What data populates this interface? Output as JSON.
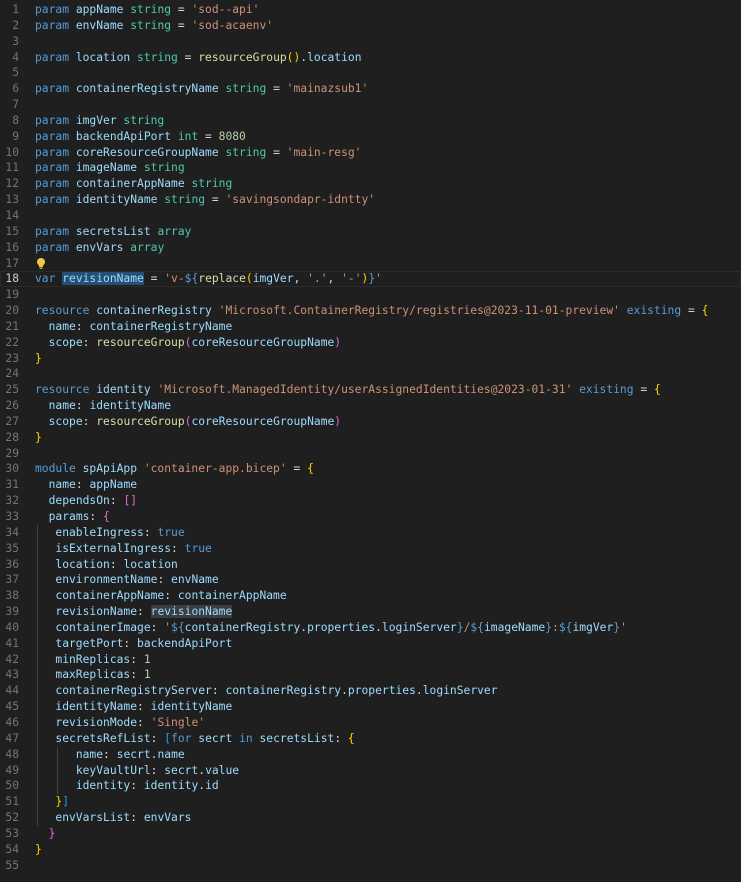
{
  "editor": {
    "current_line": 18,
    "lines": [
      {
        "n": "1",
        "t": [
          [
            "kw",
            "param "
          ],
          [
            "id",
            "appName "
          ],
          [
            "ty",
            "string"
          ],
          [
            "pl",
            " = "
          ],
          [
            "st",
            "'sod--api'"
          ]
        ]
      },
      {
        "n": "2",
        "t": [
          [
            "kw",
            "param "
          ],
          [
            "id",
            "envName "
          ],
          [
            "ty",
            "string"
          ],
          [
            "pl",
            " = "
          ],
          [
            "st",
            "'sod-acaenv'"
          ]
        ]
      },
      {
        "n": "3",
        "t": []
      },
      {
        "n": "4",
        "t": [
          [
            "kw",
            "param "
          ],
          [
            "id",
            "location "
          ],
          [
            "ty",
            "string"
          ],
          [
            "pl",
            " = "
          ],
          [
            "fn",
            "resourceGroup"
          ],
          [
            "b1",
            "()"
          ],
          [
            "pl",
            "."
          ],
          [
            "id",
            "location"
          ]
        ]
      },
      {
        "n": "5",
        "t": []
      },
      {
        "n": "6",
        "t": [
          [
            "kw",
            "param "
          ],
          [
            "id",
            "containerRegistryName "
          ],
          [
            "ty",
            "string"
          ],
          [
            "pl",
            " = "
          ],
          [
            "st",
            "'mainazsub1'"
          ]
        ]
      },
      {
        "n": "7",
        "t": []
      },
      {
        "n": "8",
        "t": [
          [
            "kw",
            "param "
          ],
          [
            "id",
            "imgVer "
          ],
          [
            "ty",
            "string"
          ]
        ]
      },
      {
        "n": "9",
        "t": [
          [
            "kw",
            "param "
          ],
          [
            "id",
            "backendApiPort "
          ],
          [
            "ty",
            "int"
          ],
          [
            "pl",
            " = "
          ],
          [
            "nu",
            "8080"
          ]
        ]
      },
      {
        "n": "10",
        "t": [
          [
            "kw",
            "param "
          ],
          [
            "id",
            "coreResourceGroupName "
          ],
          [
            "ty",
            "string"
          ],
          [
            "pl",
            " = "
          ],
          [
            "st",
            "'main-resg'"
          ]
        ]
      },
      {
        "n": "11",
        "t": [
          [
            "kw",
            "param "
          ],
          [
            "id",
            "imageName "
          ],
          [
            "ty",
            "string"
          ]
        ]
      },
      {
        "n": "12",
        "t": [
          [
            "kw",
            "param "
          ],
          [
            "id",
            "containerAppName "
          ],
          [
            "ty",
            "string"
          ]
        ]
      },
      {
        "n": "13",
        "t": [
          [
            "kw",
            "param "
          ],
          [
            "id",
            "identityName "
          ],
          [
            "ty",
            "string"
          ],
          [
            "pl",
            " = "
          ],
          [
            "st",
            "'savingsondapr-idntty'"
          ]
        ]
      },
      {
        "n": "14",
        "t": []
      },
      {
        "n": "15",
        "t": [
          [
            "kw",
            "param "
          ],
          [
            "id",
            "secretsList "
          ],
          [
            "ty",
            "array"
          ]
        ]
      },
      {
        "n": "16",
        "t": [
          [
            "kw",
            "param "
          ],
          [
            "id",
            "envVars "
          ],
          [
            "ty",
            "array"
          ]
        ]
      },
      {
        "n": "17",
        "t": [],
        "bulb": true
      },
      {
        "n": "18",
        "t": [
          [
            "kw",
            "var "
          ],
          [
            "hl",
            "revisionName"
          ],
          [
            "pl",
            " = "
          ],
          [
            "st",
            "'v-"
          ],
          [
            "kw",
            "${"
          ],
          [
            "fn",
            "replace"
          ],
          [
            "b1",
            "("
          ],
          [
            "id",
            "imgVer"
          ],
          [
            "pl",
            ", "
          ],
          [
            "st",
            "'.'"
          ],
          [
            "pl",
            ", "
          ],
          [
            "st",
            "'-'"
          ],
          [
            "b1",
            ")"
          ],
          [
            "kw",
            "}"
          ],
          [
            "st",
            "'"
          ]
        ]
      },
      {
        "n": "19",
        "t": []
      },
      {
        "n": "20",
        "t": [
          [
            "kw",
            "resource "
          ],
          [
            "id",
            "containerRegistry "
          ],
          [
            "st",
            "'Microsoft.ContainerRegistry/registries@2023-11-01-preview'"
          ],
          [
            "kw",
            " existing"
          ],
          [
            "pl",
            " = "
          ],
          [
            "b1",
            "{"
          ]
        ]
      },
      {
        "n": "21",
        "t": [
          [
            "pl",
            "  "
          ],
          [
            "id",
            "name"
          ],
          [
            "pl",
            ": "
          ],
          [
            "id",
            "containerRegistryName"
          ]
        ]
      },
      {
        "n": "22",
        "t": [
          [
            "pl",
            "  "
          ],
          [
            "id",
            "scope"
          ],
          [
            "pl",
            ": "
          ],
          [
            "fn",
            "resourceGroup"
          ],
          [
            "b2",
            "("
          ],
          [
            "id",
            "coreResourceGroupName"
          ],
          [
            "b2",
            ")"
          ]
        ]
      },
      {
        "n": "23",
        "t": [
          [
            "b1",
            "}"
          ]
        ]
      },
      {
        "n": "24",
        "t": []
      },
      {
        "n": "25",
        "t": [
          [
            "kw",
            "resource "
          ],
          [
            "id",
            "identity "
          ],
          [
            "st",
            "'Microsoft.ManagedIdentity/userAssignedIdentities@2023-01-31'"
          ],
          [
            "kw",
            " existing"
          ],
          [
            "pl",
            " = "
          ],
          [
            "b1",
            "{"
          ]
        ]
      },
      {
        "n": "26",
        "t": [
          [
            "pl",
            "  "
          ],
          [
            "id",
            "name"
          ],
          [
            "pl",
            ": "
          ],
          [
            "id",
            "identityName"
          ]
        ]
      },
      {
        "n": "27",
        "t": [
          [
            "pl",
            "  "
          ],
          [
            "id",
            "scope"
          ],
          [
            "pl",
            ": "
          ],
          [
            "fn",
            "resourceGroup"
          ],
          [
            "b2",
            "("
          ],
          [
            "id",
            "coreResourceGroupName"
          ],
          [
            "b2",
            ")"
          ]
        ]
      },
      {
        "n": "28",
        "t": [
          [
            "b1",
            "}"
          ]
        ]
      },
      {
        "n": "29",
        "t": []
      },
      {
        "n": "30",
        "t": [
          [
            "kw",
            "module "
          ],
          [
            "id",
            "spApiApp "
          ],
          [
            "st",
            "'container-app.bicep'"
          ],
          [
            "pl",
            " = "
          ],
          [
            "b1",
            "{"
          ]
        ]
      },
      {
        "n": "31",
        "t": [
          [
            "pl",
            "  "
          ],
          [
            "id",
            "name"
          ],
          [
            "pl",
            ": "
          ],
          [
            "id",
            "appName"
          ]
        ]
      },
      {
        "n": "32",
        "t": [
          [
            "pl",
            "  "
          ],
          [
            "id",
            "dependsOn"
          ],
          [
            "pl",
            ": "
          ],
          [
            "b2",
            "[]"
          ]
        ]
      },
      {
        "n": "33",
        "t": [
          [
            "pl",
            "  "
          ],
          [
            "id",
            "params"
          ],
          [
            "pl",
            ": "
          ],
          [
            "b2",
            "{"
          ]
        ]
      },
      {
        "n": "34",
        "t": [
          [
            "g",
            ""
          ],
          [
            "pl",
            "   "
          ],
          [
            "id",
            "enableIngress"
          ],
          [
            "pl",
            ": "
          ],
          [
            "kw",
            "true"
          ]
        ]
      },
      {
        "n": "35",
        "t": [
          [
            "g",
            ""
          ],
          [
            "pl",
            "   "
          ],
          [
            "id",
            "isExternalIngress"
          ],
          [
            "pl",
            ": "
          ],
          [
            "kw",
            "true"
          ]
        ]
      },
      {
        "n": "36",
        "t": [
          [
            "g",
            ""
          ],
          [
            "pl",
            "   "
          ],
          [
            "id",
            "location"
          ],
          [
            "pl",
            ": "
          ],
          [
            "id",
            "location"
          ]
        ]
      },
      {
        "n": "37",
        "t": [
          [
            "g",
            ""
          ],
          [
            "pl",
            "   "
          ],
          [
            "id",
            "environmentName"
          ],
          [
            "pl",
            ": "
          ],
          [
            "id",
            "envName"
          ]
        ]
      },
      {
        "n": "38",
        "t": [
          [
            "g",
            ""
          ],
          [
            "pl",
            "   "
          ],
          [
            "id",
            "containerAppName"
          ],
          [
            "pl",
            ": "
          ],
          [
            "id",
            "containerAppName"
          ]
        ]
      },
      {
        "n": "39",
        "t": [
          [
            "g",
            ""
          ],
          [
            "pl",
            "   "
          ],
          [
            "id",
            "revisionName"
          ],
          [
            "pl",
            ": "
          ],
          [
            "hl2",
            "revisionName"
          ]
        ]
      },
      {
        "n": "40",
        "t": [
          [
            "g",
            ""
          ],
          [
            "pl",
            "   "
          ],
          [
            "id",
            "containerImage"
          ],
          [
            "pl",
            ": "
          ],
          [
            "st",
            "'"
          ],
          [
            "kw",
            "${"
          ],
          [
            "id",
            "containerRegistry"
          ],
          [
            "pl",
            "."
          ],
          [
            "id",
            "properties"
          ],
          [
            "pl",
            "."
          ],
          [
            "id",
            "loginServer"
          ],
          [
            "kw",
            "}"
          ],
          [
            "st",
            "/"
          ],
          [
            "kw",
            "${"
          ],
          [
            "id",
            "imageName"
          ],
          [
            "kw",
            "}"
          ],
          [
            "st",
            ":"
          ],
          [
            "kw",
            "${"
          ],
          [
            "id",
            "imgVer"
          ],
          [
            "kw",
            "}"
          ],
          [
            "st",
            "'"
          ]
        ]
      },
      {
        "n": "41",
        "t": [
          [
            "g",
            ""
          ],
          [
            "pl",
            "   "
          ],
          [
            "id",
            "targetPort"
          ],
          [
            "pl",
            ": "
          ],
          [
            "id",
            "backendApiPort"
          ]
        ]
      },
      {
        "n": "42",
        "t": [
          [
            "g",
            ""
          ],
          [
            "pl",
            "   "
          ],
          [
            "id",
            "minReplicas"
          ],
          [
            "pl",
            ": "
          ],
          [
            "nu",
            "1"
          ]
        ]
      },
      {
        "n": "43",
        "t": [
          [
            "g",
            ""
          ],
          [
            "pl",
            "   "
          ],
          [
            "id",
            "maxReplicas"
          ],
          [
            "pl",
            ": "
          ],
          [
            "nu",
            "1"
          ]
        ]
      },
      {
        "n": "44",
        "t": [
          [
            "g",
            ""
          ],
          [
            "pl",
            "   "
          ],
          [
            "id",
            "containerRegistryServer"
          ],
          [
            "pl",
            ": "
          ],
          [
            "id",
            "containerRegistry"
          ],
          [
            "pl",
            "."
          ],
          [
            "id",
            "properties"
          ],
          [
            "pl",
            "."
          ],
          [
            "id",
            "loginServer"
          ]
        ]
      },
      {
        "n": "45",
        "t": [
          [
            "g",
            ""
          ],
          [
            "pl",
            "   "
          ],
          [
            "id",
            "identityName"
          ],
          [
            "pl",
            ": "
          ],
          [
            "id",
            "identityName"
          ]
        ]
      },
      {
        "n": "46",
        "t": [
          [
            "g",
            ""
          ],
          [
            "pl",
            "   "
          ],
          [
            "id",
            "revisionMode"
          ],
          [
            "pl",
            ": "
          ],
          [
            "st",
            "'Single'"
          ]
        ]
      },
      {
        "n": "47",
        "t": [
          [
            "g",
            ""
          ],
          [
            "pl",
            "   "
          ],
          [
            "id",
            "secretsRefList"
          ],
          [
            "pl",
            ": "
          ],
          [
            "b3",
            "["
          ],
          [
            "kw",
            "for "
          ],
          [
            "id",
            "secrt "
          ],
          [
            "kw",
            "in "
          ],
          [
            "id",
            "secretsList"
          ],
          [
            "pl",
            ": "
          ],
          [
            "b1",
            "{"
          ]
        ]
      },
      {
        "n": "48",
        "t": [
          [
            "g",
            ""
          ],
          [
            "pl",
            "   "
          ],
          [
            "g",
            ""
          ],
          [
            "pl",
            "   "
          ],
          [
            "id",
            "name"
          ],
          [
            "pl",
            ": "
          ],
          [
            "id",
            "secrt"
          ],
          [
            "pl",
            "."
          ],
          [
            "id",
            "name"
          ]
        ]
      },
      {
        "n": "49",
        "t": [
          [
            "g",
            ""
          ],
          [
            "pl",
            "   "
          ],
          [
            "g",
            ""
          ],
          [
            "pl",
            "   "
          ],
          [
            "id",
            "keyVaultUrl"
          ],
          [
            "pl",
            ": "
          ],
          [
            "id",
            "secrt"
          ],
          [
            "pl",
            "."
          ],
          [
            "id",
            "value"
          ]
        ]
      },
      {
        "n": "50",
        "t": [
          [
            "g",
            ""
          ],
          [
            "pl",
            "   "
          ],
          [
            "g",
            ""
          ],
          [
            "pl",
            "   "
          ],
          [
            "id",
            "identity"
          ],
          [
            "pl",
            ": "
          ],
          [
            "id",
            "identity"
          ],
          [
            "pl",
            "."
          ],
          [
            "id",
            "id"
          ]
        ]
      },
      {
        "n": "51",
        "t": [
          [
            "g",
            ""
          ],
          [
            "pl",
            "   "
          ],
          [
            "b1",
            "}"
          ],
          [
            "b3",
            "]"
          ]
        ]
      },
      {
        "n": "52",
        "t": [
          [
            "g",
            ""
          ],
          [
            "pl",
            "   "
          ],
          [
            "id",
            "envVarsList"
          ],
          [
            "pl",
            ": "
          ],
          [
            "id",
            "envVars"
          ]
        ]
      },
      {
        "n": "53",
        "t": [
          [
            "pl",
            "  "
          ],
          [
            "b2",
            "}"
          ]
        ]
      },
      {
        "n": "54",
        "t": [
          [
            "b1",
            "}"
          ]
        ]
      },
      {
        "n": "55",
        "t": []
      }
    ]
  }
}
